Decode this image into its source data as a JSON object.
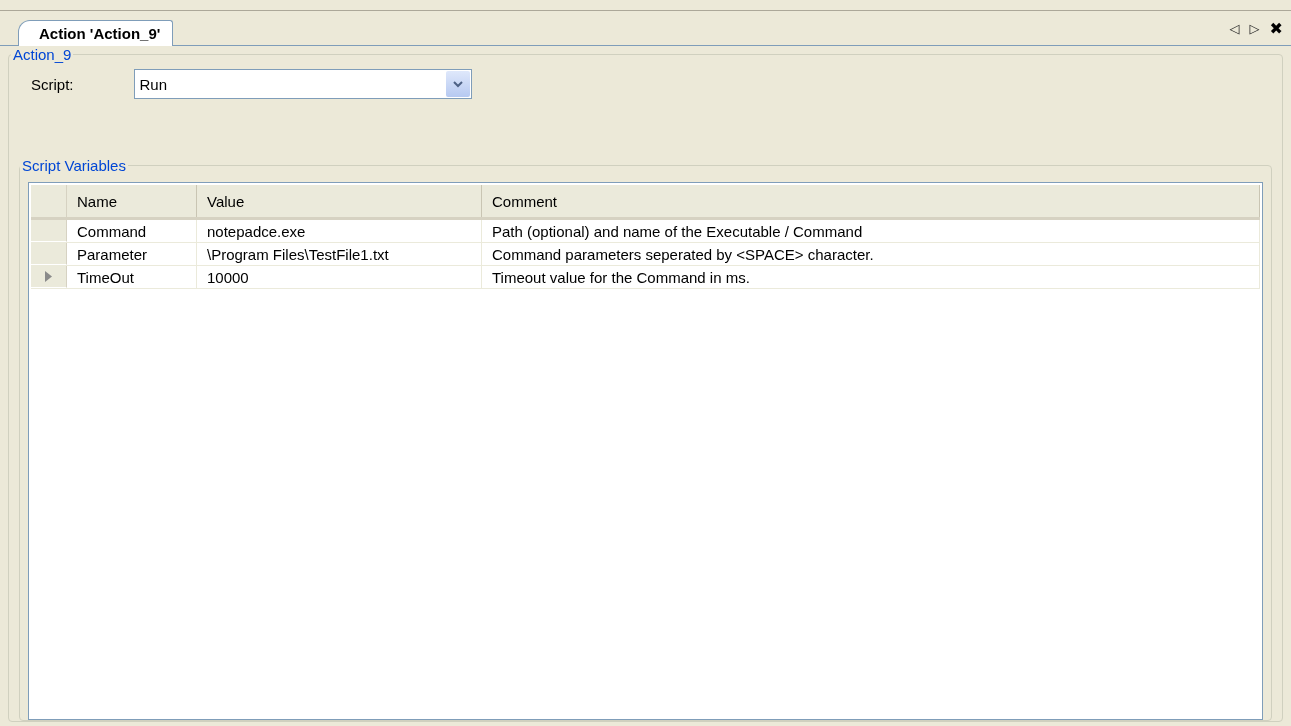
{
  "tab": {
    "label": "Action 'Action_9'",
    "selected": true
  },
  "tab_nav": {
    "prev": "◁",
    "next": "▷",
    "close": "✖"
  },
  "group": {
    "title": "Action_9"
  },
  "script": {
    "label": "Script:",
    "value": "Run"
  },
  "variables": {
    "title": "Script Variables",
    "columns": [
      "Name",
      "Value",
      "Comment"
    ],
    "rows": [
      {
        "name": "Command",
        "value": "notepadce.exe",
        "comment": "Path (optional) and name of the Executable / Command",
        "selected": false
      },
      {
        "name": "Parameter",
        "value": "\\Program Files\\TestFile1.txt",
        "comment": "Command parameters seperated by <SPACE> character.",
        "selected": false
      },
      {
        "name": "TimeOut",
        "value": "10000",
        "comment": "Timeout value for the Command in ms.",
        "selected": true
      }
    ]
  }
}
